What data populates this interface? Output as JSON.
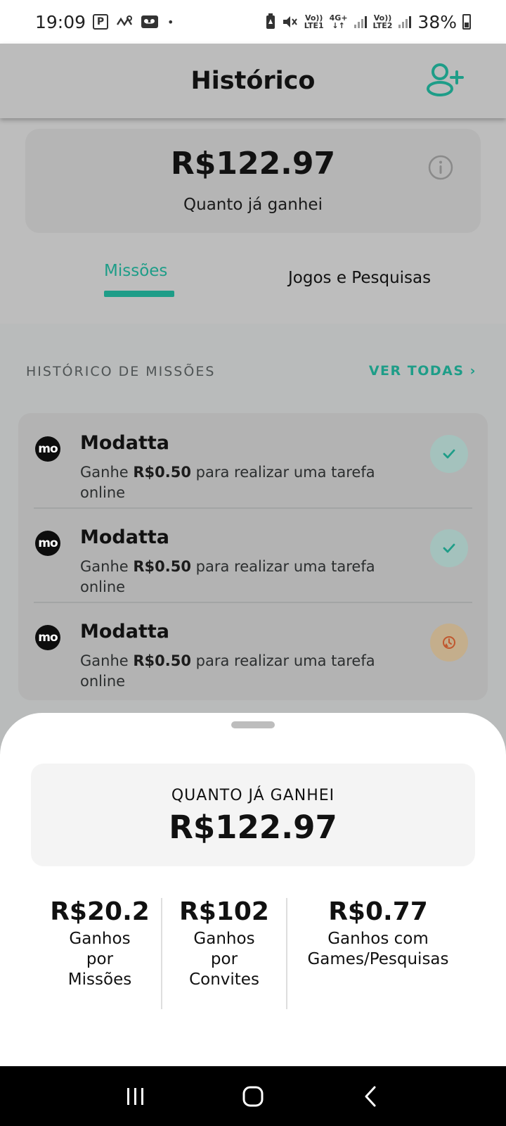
{
  "status_bar": {
    "time": "19:09",
    "battery": "38%",
    "sim1": "Vo))\nLTE1",
    "sim2": "Vo))\nLTE2",
    "net": "4G+"
  },
  "header": {
    "title": "Histórico",
    "add_user_icon": "add-user-icon"
  },
  "earnings": {
    "amount": "R$122.97",
    "label": "Quanto já ganhei",
    "info_icon": "info-icon"
  },
  "tabs": [
    {
      "label": "Missões",
      "active": true
    },
    {
      "label": "Jogos e Pesquisas",
      "active": false
    }
  ],
  "history": {
    "title": "HISTÓRICO DE MISSÕES",
    "see_all": "VER TODAS",
    "items": [
      {
        "logo": "mo",
        "name": "Modatta",
        "desc_prefix": "Ganhe ",
        "amount": "R$0.50",
        "desc_suffix": " para realizar uma tarefa online",
        "status": "completed"
      },
      {
        "logo": "mo",
        "name": "Modatta",
        "desc_prefix": "Ganhe ",
        "amount": "R$0.50",
        "desc_suffix": " para realizar uma tarefa online",
        "status": "completed"
      },
      {
        "logo": "mo",
        "name": "Modatta",
        "desc_prefix": "Ganhe ",
        "amount": "R$0.50",
        "desc_suffix": " para realizar uma tarefa online",
        "status": "pending"
      }
    ]
  },
  "sheet": {
    "total_label": "QUANTO JÁ GANHEI",
    "total_amount": "R$122.97",
    "breakdown": [
      {
        "value": "R$20.2",
        "label_lines": [
          "Ganhos",
          "por",
          "Missões"
        ]
      },
      {
        "value": "R$102",
        "label_lines": [
          "Ganhos",
          "por",
          "Convites"
        ]
      },
      {
        "value": "R$0.77",
        "label_lines": [
          "Ganhos com",
          "Games/Pesquisas"
        ]
      }
    ]
  },
  "colors": {
    "accent": "#1e9d88",
    "pending": "#c4ae8c",
    "done": "#a4c2bd"
  }
}
